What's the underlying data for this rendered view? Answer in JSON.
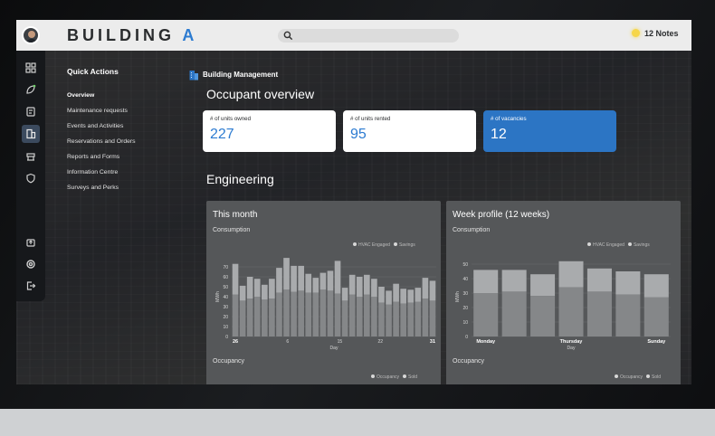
{
  "header": {
    "brand_main": "BUILDING",
    "brand_accent": "A",
    "notes_label": "12 Notes"
  },
  "sidebar": {
    "icons": [
      "dashboard-icon",
      "leaf-icon",
      "clipboard-icon",
      "building-icon",
      "desk-icon",
      "shield-icon",
      "upload-icon",
      "support-icon",
      "logout-icon"
    ],
    "active": "building-icon"
  },
  "quick_actions": {
    "title": "Quick Actions",
    "items": [
      {
        "label": "Overview",
        "active": true
      },
      {
        "label": "Maintenance requests"
      },
      {
        "label": "Events and Activities"
      },
      {
        "label": "Reservations and Orders"
      },
      {
        "label": "Reports and Forms"
      },
      {
        "label": "Information Centre"
      },
      {
        "label": "Surveys and Perks"
      }
    ]
  },
  "section": {
    "label": "Building Management"
  },
  "occupant": {
    "title": "Occupant overview",
    "cards": [
      {
        "label": "# of units owned",
        "value": "227"
      },
      {
        "label": "# of units rented",
        "value": "95"
      },
      {
        "label": "# of vacancies",
        "value": "12",
        "highlight": true
      }
    ]
  },
  "engineering": {
    "title": "Engineering"
  },
  "panels": {
    "month": {
      "title": "This month",
      "subtitle": "Consumption",
      "legend_a": "HVAC Engaged",
      "legend_b": "Savings",
      "bottom_subtitle": "Occupancy",
      "legend2_a": "Occupancy",
      "legend2_b": "Sold"
    },
    "week": {
      "title": "Week profile (12 weeks)",
      "subtitle": "Consumption",
      "legend_a": "HVAC Engaged",
      "legend_b": "Savings",
      "bottom_subtitle": "Occupancy",
      "legend2_a": "Occupancy",
      "legend2_b": "Sold"
    }
  },
  "chart_data": [
    {
      "type": "bar",
      "title": "This month",
      "ylabel": "MWh",
      "xlabel": "Day",
      "ylim": [
        0,
        80
      ],
      "yticks": [
        0,
        10,
        20,
        30,
        40,
        50,
        60,
        70
      ],
      "xticks": [
        {
          "day": 1,
          "label": "26",
          "bold": true
        },
        {
          "day": 10,
          "label": "6"
        },
        {
          "day": 19,
          "label": "15"
        },
        {
          "day": 26,
          "label": "22"
        },
        {
          "day": 35,
          "label": "31",
          "bold": true
        }
      ],
      "series": [
        {
          "name": "HVAC Engaged",
          "values": [
            42,
            36,
            38,
            40,
            37,
            38,
            44,
            47,
            45,
            46,
            44,
            44,
            47,
            46,
            43,
            36,
            42,
            40,
            42,
            40,
            34,
            32,
            35,
            33,
            34,
            35,
            38,
            36
          ]
        },
        {
          "name": "Savings",
          "values": [
            31,
            15,
            22,
            18,
            15,
            20,
            25,
            32,
            26,
            25,
            19,
            15,
            17,
            20,
            33,
            13,
            20,
            20,
            20,
            18,
            16,
            14,
            18,
            15,
            13,
            14,
            21,
            20
          ]
        }
      ]
    },
    {
      "type": "bar",
      "title": "Week profile (12 weeks)",
      "ylabel": "MWh",
      "xlabel": "Day",
      "ylim": [
        0,
        55
      ],
      "yticks": [
        0,
        10,
        20,
        30,
        40,
        50
      ],
      "categories": [
        "Monday",
        "",
        "",
        "Thursday",
        "",
        "",
        "Sunday"
      ],
      "series": [
        {
          "name": "HVAC Engaged",
          "values": [
            30,
            31,
            28,
            34,
            31,
            29,
            27
          ]
        },
        {
          "name": "Savings",
          "values": [
            16,
            15,
            15,
            18,
            16,
            16,
            16
          ]
        }
      ]
    }
  ]
}
